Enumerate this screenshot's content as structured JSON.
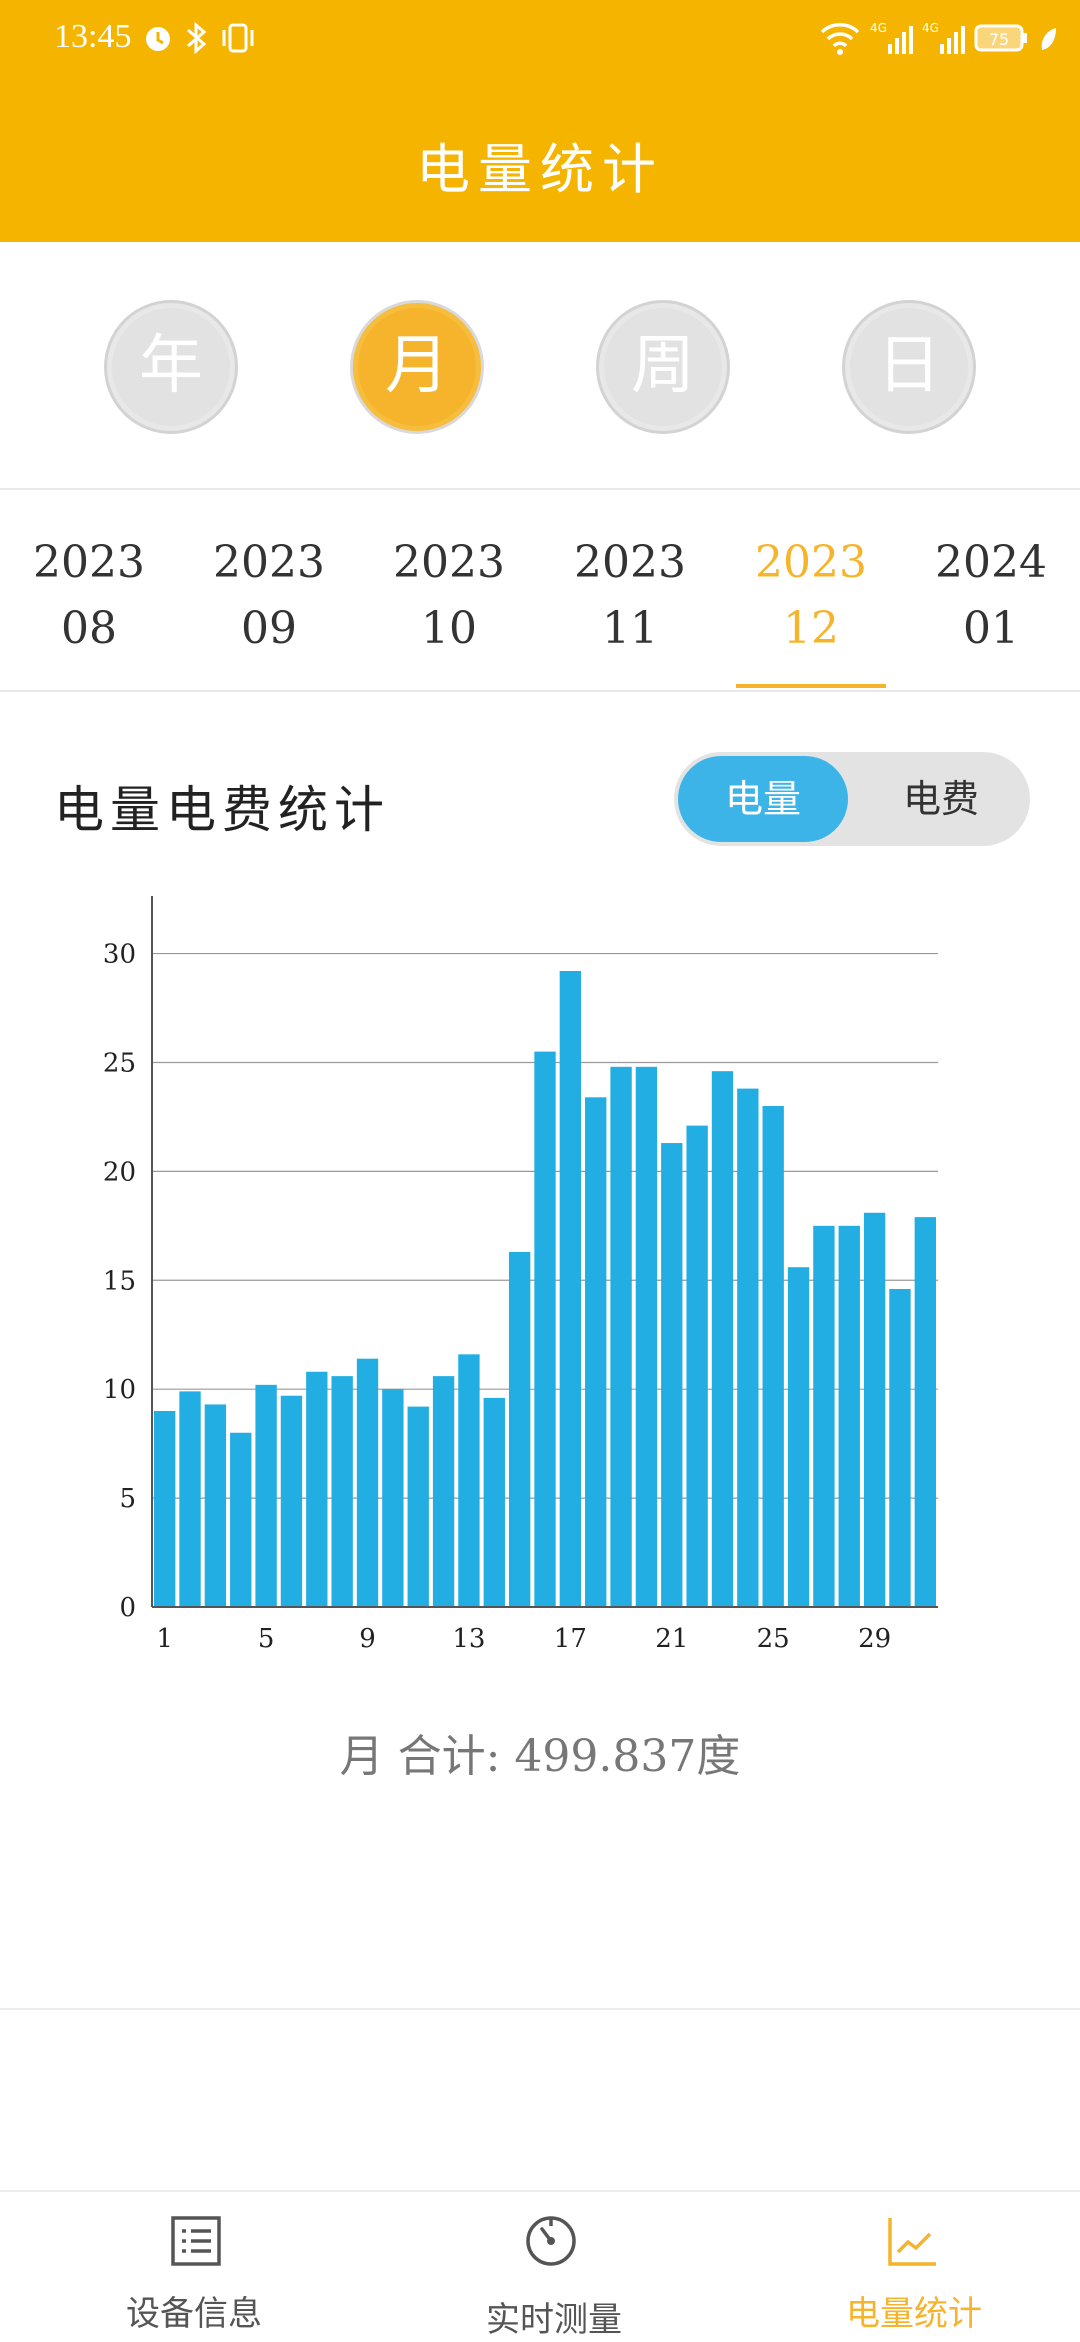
{
  "status_bar": {
    "time": "13:45",
    "battery": "75",
    "signal_1": "4G",
    "signal_2": "4G"
  },
  "header": {
    "title": "电量统计"
  },
  "period_tabs": [
    {
      "label": "年",
      "active": false
    },
    {
      "label": "月",
      "active": true
    },
    {
      "label": "周",
      "active": false
    },
    {
      "label": "日",
      "active": false
    }
  ],
  "months": [
    {
      "year": "2023",
      "month": "08"
    },
    {
      "year": "2023",
      "month": "09"
    },
    {
      "year": "2023",
      "month": "10"
    },
    {
      "year": "2023",
      "month": "11"
    },
    {
      "year": "2023",
      "month": "12",
      "active": true
    },
    {
      "year": "2024",
      "month": "01"
    }
  ],
  "stats": {
    "title": "电量电费统计",
    "toggle": {
      "left": "电量",
      "right": "电费",
      "selected": "电量"
    },
    "total_label": "月 合计:",
    "total_value": "499.837度"
  },
  "colors": {
    "header": "#F5B400",
    "accent": "#F5B42C",
    "bar": "#22AEE2",
    "toggle_active": "#3CB4E8"
  },
  "chart_data": {
    "type": "bar",
    "x": [
      1,
      2,
      3,
      4,
      5,
      6,
      7,
      8,
      9,
      10,
      11,
      12,
      13,
      14,
      15,
      16,
      17,
      18,
      19,
      20,
      21,
      22,
      23,
      24,
      25,
      26,
      27,
      28,
      29,
      30,
      31
    ],
    "values": [
      9.0,
      9.9,
      9.3,
      8.0,
      10.2,
      9.7,
      10.8,
      10.6,
      11.4,
      10.0,
      9.2,
      10.6,
      11.6,
      9.6,
      16.3,
      25.5,
      29.2,
      23.4,
      24.8,
      24.8,
      21.3,
      22.1,
      24.6,
      23.8,
      23.0,
      15.6,
      17.5,
      17.5,
      18.1,
      14.6,
      17.9
    ],
    "x_ticks": [
      "1",
      "5",
      "9",
      "13",
      "17",
      "21",
      "25",
      "29"
    ],
    "y_ticks": [
      "0",
      "5",
      "10",
      "15",
      "20",
      "25",
      "30"
    ],
    "ylim": [
      0,
      32
    ],
    "grid": true,
    "title": "",
    "xlabel": "",
    "ylabel": ""
  },
  "bottom_nav": [
    {
      "label": "设备信息",
      "icon": "list-icon",
      "active": false
    },
    {
      "label": "实时测量",
      "icon": "gauge-icon",
      "active": false
    },
    {
      "label": "电量统计",
      "icon": "line-chart-icon",
      "active": true
    }
  ]
}
